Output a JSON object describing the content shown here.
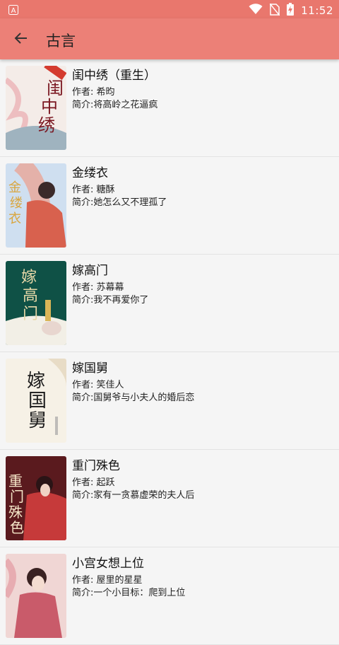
{
  "status_bar": {
    "time": "11:52",
    "icons": [
      "app-notification-icon",
      "wifi-icon",
      "no-sim-icon",
      "battery-charging-icon"
    ]
  },
  "toolbar": {
    "title": "古言",
    "back_icon": "arrow-left-icon"
  },
  "colors": {
    "status_bar": "#e9776d",
    "toolbar": "#ec8077",
    "background": "#f5f5f5"
  },
  "books": [
    {
      "title": "闺中绣（重生）",
      "author": "作者: 希昀",
      "intro": "简介:将高岭之花逼疯",
      "cover_text": "闺中绣"
    },
    {
      "title": "金缕衣",
      "author": "作者: 糖酥",
      "intro": "简介:她怎么又不理孤了",
      "cover_text": "金缕衣"
    },
    {
      "title": "嫁高门",
      "author": "作者: 苏幕幕",
      "intro": "简介:我不再爱你了",
      "cover_text": "嫁高门"
    },
    {
      "title": "嫁国舅",
      "author": "作者: 笑佳人",
      "intro": "简介:国舅爷与小夫人的婚后恋",
      "cover_text": "嫁国舅"
    },
    {
      "title": "重门殊色",
      "author": "作者: 起跃",
      "intro": "简介:家有一贪慕虚荣的夫人后",
      "cover_text": "重门殊色"
    },
    {
      "title": "小宫女想上位",
      "author": "作者: 屋里的星星",
      "intro": "简介:一个小目标：爬到上位",
      "cover_text": ""
    }
  ]
}
